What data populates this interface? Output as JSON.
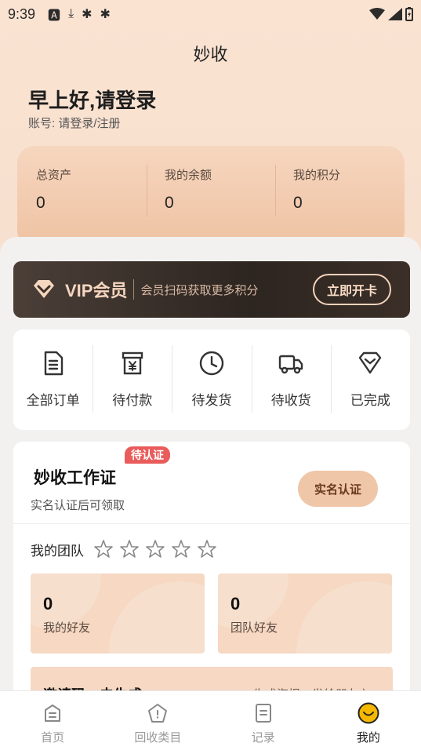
{
  "status_bar": {
    "time": "9:39",
    "icons": [
      "a-icon",
      "download-icon",
      "bug-icon",
      "bug-icon",
      "wifi-icon",
      "signal-icon",
      "battery-icon"
    ]
  },
  "header": {
    "title": "妙收"
  },
  "profile": {
    "greeting": "早上好,请登录",
    "account_label": "账号:",
    "account_value": "请登录/注册"
  },
  "assets": [
    {
      "label": "总资产",
      "value": "0"
    },
    {
      "label": "我的余额",
      "value": "0"
    },
    {
      "label": "我的积分",
      "value": "0"
    }
  ],
  "vip": {
    "title": "VIP会员",
    "description": "会员扫码获取更多积分",
    "button": "立即开卡"
  },
  "orders": [
    {
      "label": "全部订单",
      "icon": "document-icon"
    },
    {
      "label": "待付款",
      "icon": "wallet-icon"
    },
    {
      "label": "待发货",
      "icon": "clock-icon"
    },
    {
      "label": "待收货",
      "icon": "truck-icon"
    },
    {
      "label": "已完成",
      "icon": "check-diamond-icon"
    }
  ],
  "work_card": {
    "badge": "待认证",
    "title": "妙收工作证",
    "subtitle": "实名认证后可领取",
    "verify_button": "实名认证",
    "team_label": "我的团队",
    "stars": 0,
    "stats": [
      {
        "value": "0",
        "label": "我的好友"
      },
      {
        "value": "0",
        "label": "团队好友"
      }
    ],
    "invite_text": "邀请码：未生成",
    "invite_right": "生成海报，发给朋友 〉"
  },
  "bottom_nav": [
    {
      "label": "首页",
      "icon": "home-icon",
      "active": false
    },
    {
      "label": "回收类目",
      "icon": "category-icon",
      "active": false
    },
    {
      "label": "记录",
      "icon": "record-icon",
      "active": false
    },
    {
      "label": "我的",
      "icon": "smile-icon",
      "active": true
    }
  ],
  "colors": {
    "accent": "#f0c6a8",
    "vip_bg": "#2d2520",
    "badge": "#ea5b5b",
    "active_nav": "#f5b800"
  }
}
